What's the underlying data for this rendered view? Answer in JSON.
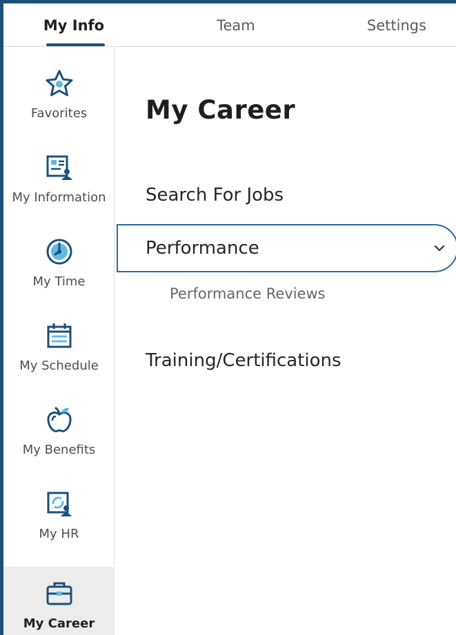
{
  "tabs": [
    {
      "label": "My Info",
      "active": true
    },
    {
      "label": "Team",
      "active": false
    },
    {
      "label": "Settings",
      "active": false
    }
  ],
  "sidebar": {
    "items": [
      {
        "label": "Favorites",
        "icon": "star-icon"
      },
      {
        "label": "My Information",
        "icon": "id-card-icon"
      },
      {
        "label": "My Time",
        "icon": "clock-icon"
      },
      {
        "label": "My Schedule",
        "icon": "calendar-icon"
      },
      {
        "label": "My Benefits",
        "icon": "apple-icon"
      },
      {
        "label": "My HR",
        "icon": "hr-documents-icon"
      },
      {
        "label": "My Career",
        "icon": "briefcase-icon",
        "active": true
      }
    ]
  },
  "main": {
    "title": "My Career",
    "links": {
      "search_jobs": "Search For Jobs",
      "performance": "Performance",
      "performance_reviews": "Performance Reviews",
      "training": "Training/Certifications"
    }
  },
  "colors": {
    "accent": "#1b4f7a",
    "focus_border": "#2b6a99",
    "active_sidebar_bg": "#ececec"
  }
}
